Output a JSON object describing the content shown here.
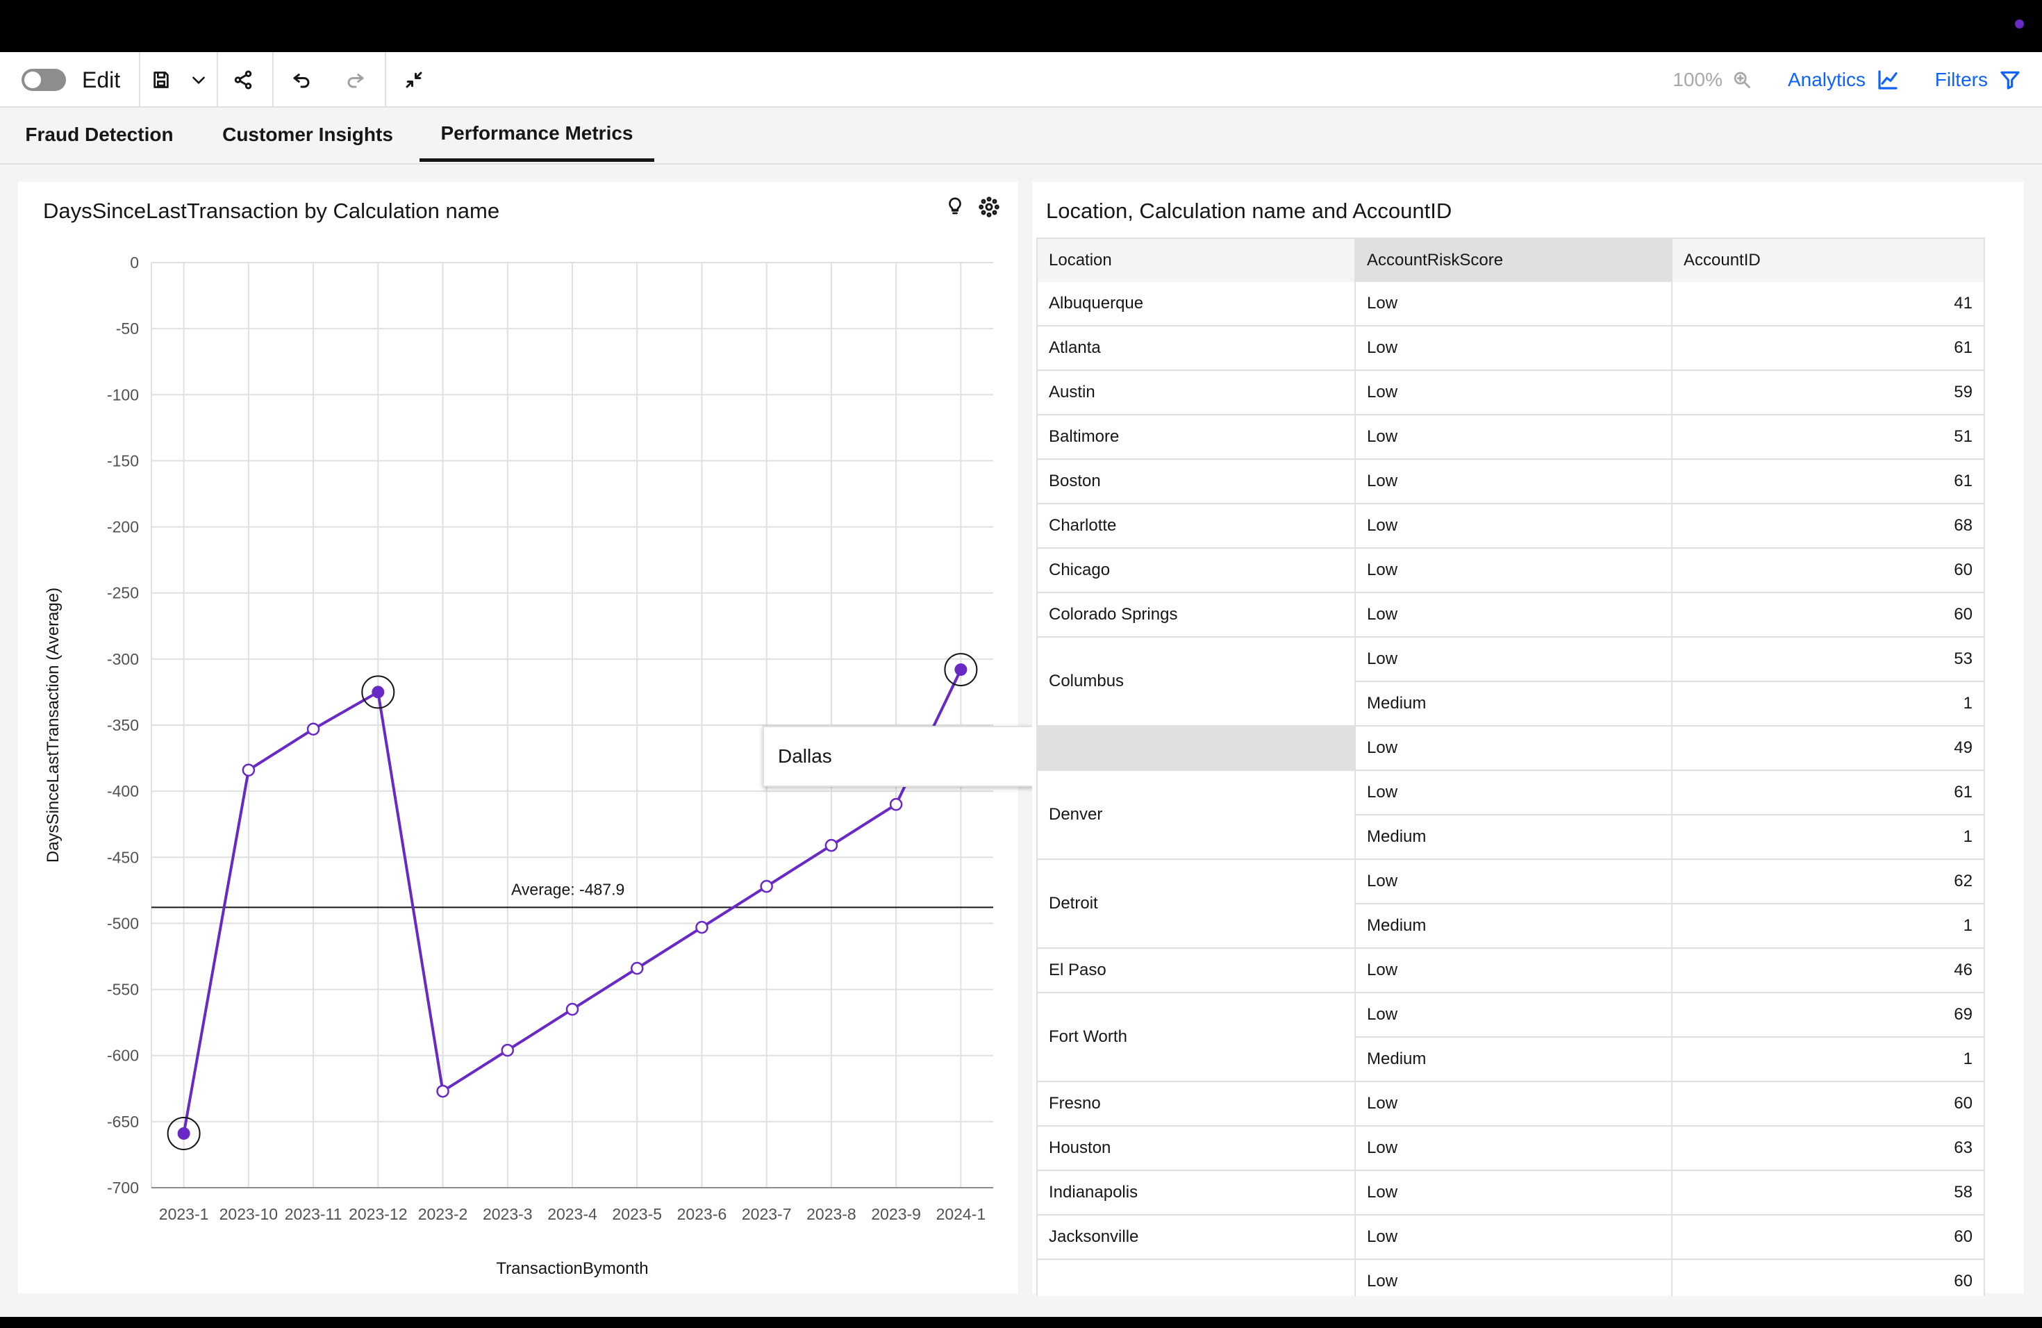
{
  "toolbar": {
    "edit_label": "Edit",
    "zoom": "100%",
    "analytics_label": "Analytics",
    "filters_label": "Filters"
  },
  "tabs": [
    {
      "label": "Fraud Detection",
      "active": false
    },
    {
      "label": "Customer Insights",
      "active": false
    },
    {
      "label": "Performance Metrics",
      "active": true
    }
  ],
  "chart_panel": {
    "title": "DaysSinceLastTransaction by Calculation name",
    "tooltip": "Dallas",
    "chart_data": {
      "type": "line",
      "xlabel": "TransactionBymonth",
      "ylabel": "DaysSinceLastTransaction (Average)",
      "ylim": [
        -700,
        0
      ],
      "yticks": [
        0,
        -50,
        -100,
        -150,
        -200,
        -250,
        -300,
        -350,
        -400,
        -450,
        -500,
        -550,
        -600,
        -650,
        -700
      ],
      "categories": [
        "2023-1",
        "2023-10",
        "2023-11",
        "2023-12",
        "2023-2",
        "2023-3",
        "2023-4",
        "2023-5",
        "2023-6",
        "2023-7",
        "2023-8",
        "2023-9",
        "2024-1"
      ],
      "series": [
        {
          "values": [
            -659,
            -384,
            -353,
            -325,
            -627,
            -596,
            -565,
            -534,
            -503,
            -472,
            -441,
            -410,
            -308
          ],
          "color": "#6929c4"
        }
      ],
      "highlighted_points": [
        "2023-1",
        "2023-12",
        "2024-1"
      ],
      "average_line": {
        "value": -487.9,
        "label": "Average: -487.9"
      },
      "grid": true
    }
  },
  "table_panel": {
    "title": "Location, Calculation name and AccountID",
    "columns": [
      "Location",
      "AccountRiskScore",
      "AccountID"
    ],
    "groups": [
      {
        "location": "Albuquerque",
        "rows": [
          [
            "Low",
            "41"
          ]
        ]
      },
      {
        "location": "Atlanta",
        "rows": [
          [
            "Low",
            "61"
          ]
        ]
      },
      {
        "location": "Austin",
        "rows": [
          [
            "Low",
            "59"
          ]
        ]
      },
      {
        "location": "Baltimore",
        "rows": [
          [
            "Low",
            "51"
          ]
        ]
      },
      {
        "location": "Boston",
        "rows": [
          [
            "Low",
            "61"
          ]
        ]
      },
      {
        "location": "Charlotte",
        "rows": [
          [
            "Low",
            "68"
          ]
        ]
      },
      {
        "location": "Chicago",
        "rows": [
          [
            "Low",
            "60"
          ]
        ]
      },
      {
        "location": "Colorado Springs",
        "rows": [
          [
            "Low",
            "60"
          ]
        ]
      },
      {
        "location": "Columbus",
        "rows": [
          [
            "Low",
            "53"
          ],
          [
            "Medium",
            "1"
          ]
        ]
      },
      {
        "location": "",
        "rows": [
          [
            "Low",
            "49"
          ]
        ],
        "selected": true
      },
      {
        "location": "Denver",
        "rows": [
          [
            "Low",
            "61"
          ],
          [
            "Medium",
            "1"
          ]
        ]
      },
      {
        "location": "Detroit",
        "rows": [
          [
            "Low",
            "62"
          ],
          [
            "Medium",
            "1"
          ]
        ]
      },
      {
        "location": "El Paso",
        "rows": [
          [
            "Low",
            "46"
          ]
        ]
      },
      {
        "location": "Fort Worth",
        "rows": [
          [
            "Low",
            "69"
          ],
          [
            "Medium",
            "1"
          ]
        ]
      },
      {
        "location": "Fresno",
        "rows": [
          [
            "Low",
            "60"
          ]
        ]
      },
      {
        "location": "Houston",
        "rows": [
          [
            "Low",
            "63"
          ]
        ]
      },
      {
        "location": "Indianapolis",
        "rows": [
          [
            "Low",
            "58"
          ]
        ]
      },
      {
        "location": "Jacksonville",
        "rows": [
          [
            "Low",
            "60"
          ]
        ]
      },
      {
        "location": "",
        "rows": [
          [
            "Low",
            "60"
          ]
        ]
      }
    ]
  }
}
